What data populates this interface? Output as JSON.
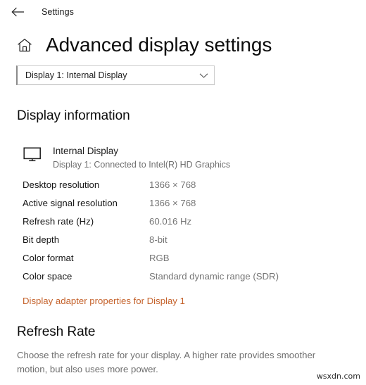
{
  "titlebar": {
    "back_icon": "back-arrow-icon",
    "app_title": "Settings"
  },
  "header": {
    "home_icon": "home-icon",
    "page_title": "Advanced display settings"
  },
  "display_selector": {
    "selected": "Display 1: Internal Display",
    "chevron_icon": "chevron-down-icon"
  },
  "display_information": {
    "section_title": "Display information",
    "monitor_icon": "monitor-icon",
    "monitor_name": "Internal Display",
    "monitor_subtitle": "Display 1: Connected to Intel(R) HD Graphics",
    "specs": [
      {
        "label": "Desktop resolution",
        "value": "1366 × 768"
      },
      {
        "label": "Active signal resolution",
        "value": "1366 × 768"
      },
      {
        "label": "Refresh rate (Hz)",
        "value": "60.016 Hz"
      },
      {
        "label": "Bit depth",
        "value": "8-bit"
      },
      {
        "label": "Color format",
        "value": "RGB"
      },
      {
        "label": "Color space",
        "value": "Standard dynamic range (SDR)"
      }
    ],
    "adapter_link": "Display adapter properties for Display 1"
  },
  "refresh_rate": {
    "section_title": "Refresh Rate",
    "description": "Choose the refresh rate for your display. A higher rate provides smoother motion, but also uses more power."
  },
  "watermark": "wsxdn.com",
  "colors": {
    "link": "#c4612a",
    "value_text": "#767676",
    "body_text": "#6e6e6e",
    "heading_text": "#0c0c0c"
  }
}
